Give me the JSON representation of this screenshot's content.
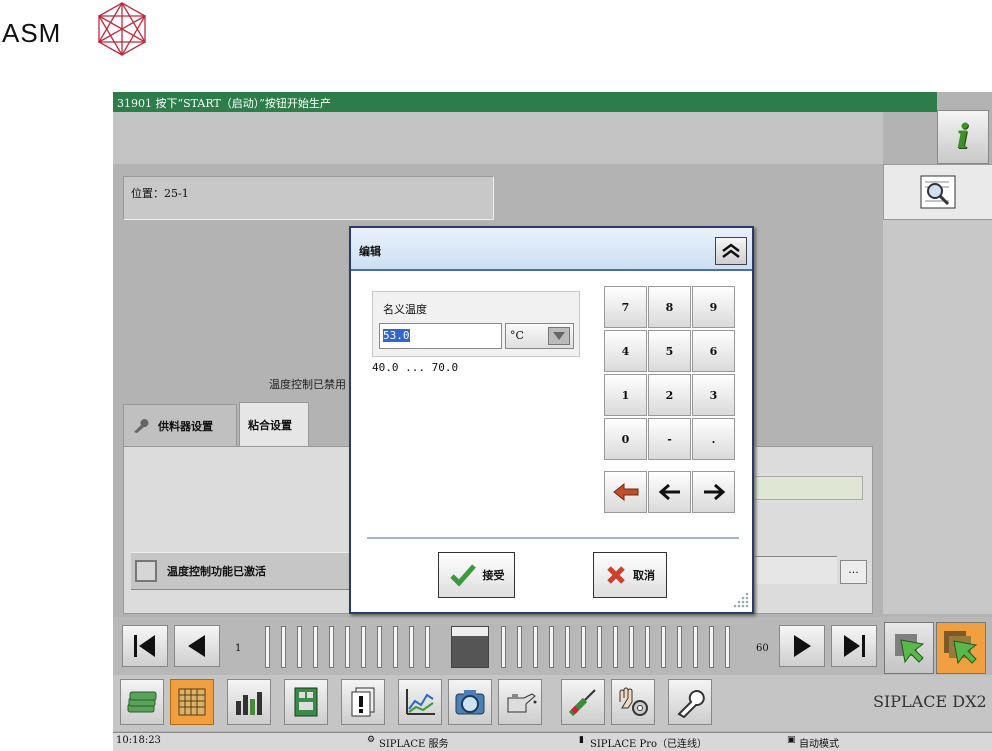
{
  "brand": {
    "name": "ASM"
  },
  "app": {
    "title": "31901 按下“START（启动）”按钮开始生产",
    "position_label": "位置：25-1",
    "temp_status": "温度控制已禁用",
    "tabs": [
      {
        "label": "供料器设置"
      },
      {
        "label": "粘合设置"
      }
    ],
    "checkbox_label": "温度控制功能已激活",
    "dots_label": "...",
    "product": "SIPLACE DX2"
  },
  "nav": {
    "first_page": "1",
    "last_page": "60"
  },
  "status": {
    "time": "10:18:23",
    "service": "SIPLACE 服务",
    "pro": "SIPLACE Pro（已连线）",
    "mode": "自动模式"
  },
  "dialog": {
    "title": "编辑",
    "field_label": "名义温度",
    "value": "53.0",
    "unit": "°C",
    "range": "40.0 ... 70.0",
    "keys": [
      "7",
      "8",
      "9",
      "4",
      "5",
      "6",
      "1",
      "2",
      "3",
      "0",
      "-",
      "."
    ],
    "accept_label": "接受",
    "cancel_label": "取消"
  },
  "colors": {
    "titlebar": "#2d7d4a",
    "accent_orange": "#f0a040",
    "dialog_header": "#cddff2"
  },
  "icons": [
    "info-icon",
    "zoom-icon",
    "wrench-icon",
    "first-page-icon",
    "prev-page-icon",
    "next-page-icon",
    "last-page-icon",
    "money-icon",
    "grid-icon",
    "bar-chart-icon",
    "board-icon",
    "warning-doc-icon",
    "line-chart-icon",
    "camera-icon",
    "oil-can-icon",
    "screwdriver-icon",
    "hand-gear-icon",
    "wrench-tool-icon",
    "checkmark-icon",
    "cross-icon",
    "collapse-icon"
  ]
}
